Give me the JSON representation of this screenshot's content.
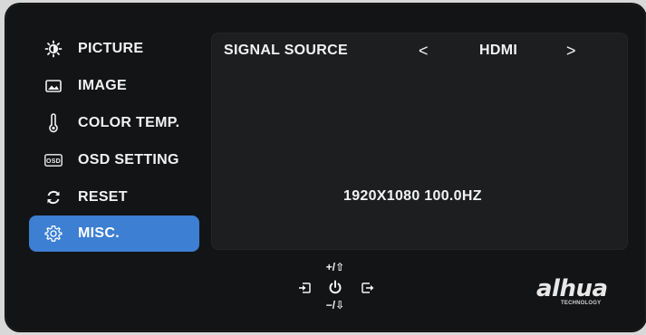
{
  "menu": {
    "items": [
      {
        "label": "PICTURE",
        "icon": "brightness-icon",
        "active": false
      },
      {
        "label": "IMAGE",
        "icon": "image-icon",
        "active": false
      },
      {
        "label": "COLOR TEMP.",
        "icon": "thermometer-icon",
        "active": false
      },
      {
        "label": "OSD SETTING",
        "icon": "osd-icon",
        "active": false
      },
      {
        "label": "RESET",
        "icon": "reset-icon",
        "active": false
      },
      {
        "label": "MISC.",
        "icon": "gear-icon",
        "active": true
      }
    ]
  },
  "panel": {
    "signal_source_label": "SIGNAL SOURCE",
    "signal_source_value": "HDMI",
    "prev_arrow": "<",
    "next_arrow": ">",
    "resolution_status": "1920X1080 100.0HZ"
  },
  "controls": {
    "up_label": "+/⇧",
    "down_label": "−/⇩"
  },
  "branding": {
    "logo_text": "alhua",
    "logo_subtext": "TECHNOLOGY"
  },
  "colors": {
    "active_item": "#3c7fd3",
    "panel_bg": "#1d1e20",
    "bezel_bg": "#131416",
    "text": "#f2f2f2"
  }
}
